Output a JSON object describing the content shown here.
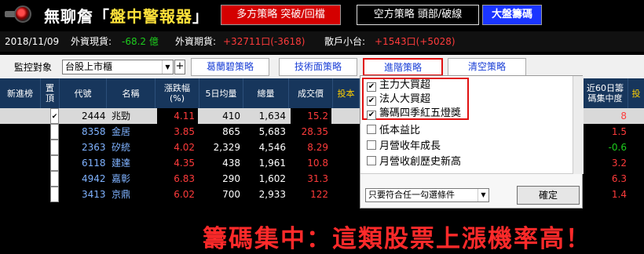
{
  "app": {
    "title_prefix": "無聊詹「",
    "title_main": "盤中警報器",
    "title_suffix": "」"
  },
  "top_buttons": {
    "multi": "多方策略 突破/回檔",
    "short": "空方策略 頭部/破線",
    "market": "大盤籌碼"
  },
  "info": {
    "date": "2018/11/09",
    "spot_label": "外資現貨:",
    "spot_value": "-68.2 億",
    "futures_label": "外資期貨:",
    "futures_value": "+32711口(-3618)",
    "retail_label": "散戶小台:",
    "retail_value": "+1543口(+5028)"
  },
  "filter": {
    "label": "監控對象",
    "combo_value": "台股上市櫃",
    "plus": "+",
    "tabs": [
      "葛蘭碧策略",
      "技術面策略",
      "進階策略",
      "清空策略"
    ]
  },
  "table": {
    "headers": [
      "新進榜",
      "置頂",
      "代號",
      "名稱",
      "漲跌幅(%)",
      "5日均量",
      "總量",
      "成交價",
      "投本",
      "近60日籌碼集中度",
      "投"
    ],
    "rows": [
      {
        "checked": "✔",
        "code": "2444",
        "name": "兆勁",
        "change": "4.11",
        "avg5": "410",
        "vol": "1,634",
        "price": "15.2",
        "conc": "8"
      },
      {
        "checked": "",
        "code": "8358",
        "name": "金居",
        "change": "3.85",
        "avg5": "865",
        "vol": "5,683",
        "price": "28.35",
        "conc": "1.5"
      },
      {
        "checked": "",
        "code": "2363",
        "name": "矽統",
        "change": "4.02",
        "avg5": "2,329",
        "vol": "4,546",
        "price": "8.29",
        "conc": "-0.6"
      },
      {
        "checked": "",
        "code": "6118",
        "name": "建達",
        "change": "4.35",
        "avg5": "438",
        "vol": "1,961",
        "price": "10.8",
        "conc": "3.2"
      },
      {
        "checked": "",
        "code": "4942",
        "name": "嘉彰",
        "change": "6.83",
        "avg5": "290",
        "vol": "1,602",
        "price": "31.3",
        "conc": "6.3"
      },
      {
        "checked": "",
        "code": "3413",
        "name": "京鼎",
        "change": "6.02",
        "avg5": "700",
        "vol": "2,933",
        "price": "122",
        "conc": "1.4"
      }
    ]
  },
  "popup": {
    "options": [
      {
        "label": "主力大買超",
        "checked": "✔"
      },
      {
        "label": "法人大買超",
        "checked": "✔"
      },
      {
        "label": "籌碼四季紅五燈獎",
        "checked": "✔"
      },
      {
        "label": "低本益比",
        "checked": ""
      },
      {
        "label": "月營收年成長",
        "checked": ""
      },
      {
        "label": "月營收創歷史新高",
        "checked": ""
      }
    ],
    "condition": "只要符合任一勾選條件",
    "ok": "確定"
  },
  "caption": "籌碼集中：這類股票上漲機率高！",
  "colors": {
    "up_red": "#ff3b3b",
    "down_green": "#1dcc1d",
    "header_blue": "#17365c",
    "tab_red_border": "#e01010"
  }
}
